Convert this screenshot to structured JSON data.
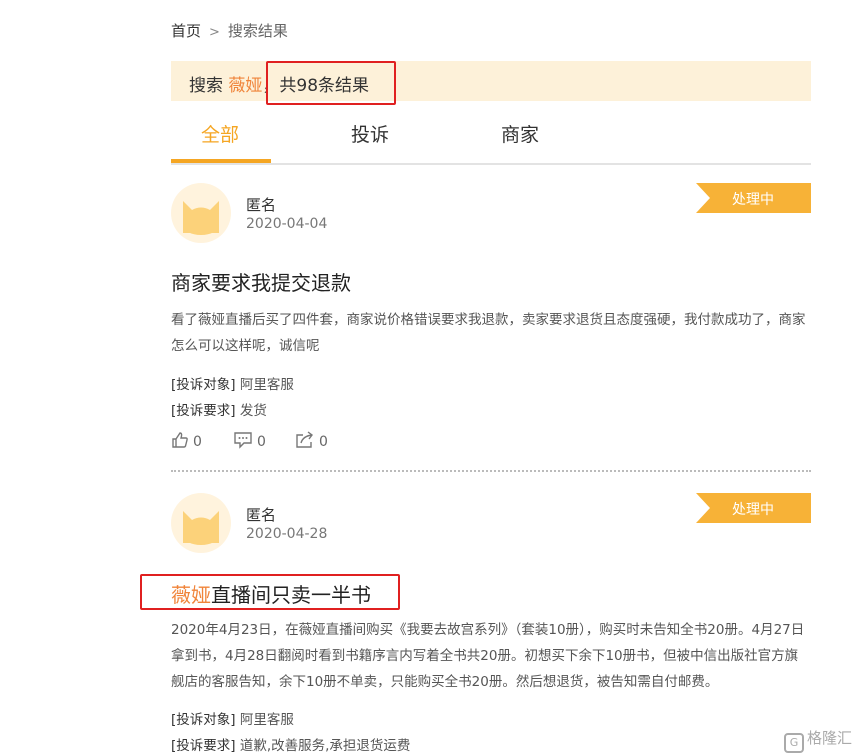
{
  "breadcrumb": {
    "home": "首页",
    "separator": ">",
    "current": "搜索结果"
  },
  "search": {
    "prefix": "搜索 ",
    "keyword": "薇娅",
    "summary": "，共98条结果"
  },
  "tabs": [
    {
      "label": "全部",
      "active": true
    },
    {
      "label": "投诉",
      "active": false
    },
    {
      "label": "商家",
      "active": false
    }
  ],
  "complaints": [
    {
      "user": "匿名",
      "date": "2020-04-04",
      "status": "处理中",
      "title_keyword": "",
      "title_rest": "商家要求我提交退款",
      "description": "看了薇娅直播后买了四件套，商家说价格错误要求我退款，卖家要求退货且态度强硬，我付款成功了，商家怎么可以这样呢，诚信呢",
      "target_label": "[投诉对象]",
      "target": "阿里客服",
      "demand_label": "[投诉要求]",
      "demand": "发货",
      "likes": "0",
      "comments": "0",
      "shares": "0"
    },
    {
      "user": "匿名",
      "date": "2020-04-28",
      "status": "处理中",
      "title_keyword": "薇娅",
      "title_rest": "直播间只卖一半书",
      "description": "2020年4月23日，在薇娅直播间购买《我要去故宫系列》（套装10册），购买时未告知全书20册。4月27日拿到书，4月28日翻阅时看到书籍序言内写着全书共20册。初想买下余下10册书，但被中信出版社官方旗舰店的客服告知，余下10册不单卖，只能购买全书20册。然后想退货，被告知需自付邮费。",
      "target_label": "[投诉对象]",
      "target": "阿里客服",
      "demand_label": "[投诉要求]",
      "demand": "道歉,改善服务,承担退货运费"
    }
  ],
  "watermark": {
    "glyph": "G",
    "text": "格隆汇"
  },
  "colors": {
    "accent": "#f5a623",
    "keyword": "#f0843a",
    "highlight_box": "#e02020",
    "search_bg": "#fdf1d9"
  }
}
